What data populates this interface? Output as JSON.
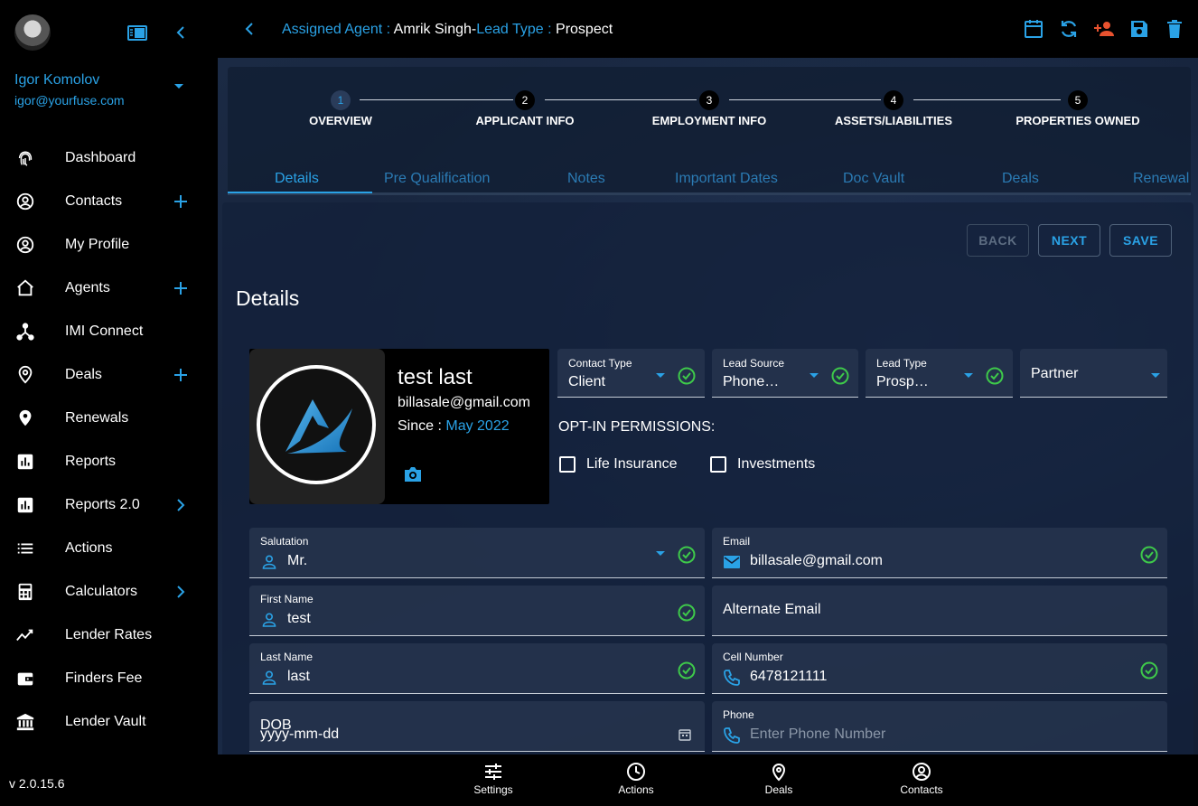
{
  "user": {
    "name": "Igor Komolov",
    "email": "igor@yourfuse.com"
  },
  "sidebar": {
    "items": [
      {
        "label": "Dashboard",
        "icon": "fingerprint-icon",
        "extra": ""
      },
      {
        "label": "Contacts",
        "icon": "account-circle-icon",
        "extra": "plus"
      },
      {
        "label": "My Profile",
        "icon": "account-circle-icon",
        "extra": ""
      },
      {
        "label": "Agents",
        "icon": "home-icon",
        "extra": "plus"
      },
      {
        "label": "IMI Connect",
        "icon": "hub-icon",
        "extra": ""
      },
      {
        "label": "Deals",
        "icon": "location-outline-icon",
        "extra": "plus"
      },
      {
        "label": "Renewals",
        "icon": "location-filled-icon",
        "extra": ""
      },
      {
        "label": "Reports",
        "icon": "bar-chart-icon",
        "extra": ""
      },
      {
        "label": "Reports 2.0",
        "icon": "bar-chart-icon",
        "extra": "chevron"
      },
      {
        "label": "Actions",
        "icon": "list-icon",
        "extra": ""
      },
      {
        "label": "Calculators",
        "icon": "calculator-icon",
        "extra": "chevron"
      },
      {
        "label": "Lender Rates",
        "icon": "trending-icon",
        "extra": ""
      },
      {
        "label": "Finders Fee",
        "icon": "wallet-icon",
        "extra": ""
      },
      {
        "label": "Lender Vault",
        "icon": "bank-icon",
        "extra": ""
      }
    ],
    "version": "v 2.0.15.6"
  },
  "header": {
    "agent_label": "Assigned Agent : ",
    "agent_value": "Amrik Singh",
    "sep": "-",
    "lead_label": "Lead Type : ",
    "lead_value": "Prospect"
  },
  "stepper": {
    "steps": [
      {
        "num": "1",
        "label": "OVERVIEW"
      },
      {
        "num": "2",
        "label": "APPLICANT INFO"
      },
      {
        "num": "3",
        "label": "EMPLOYMENT INFO"
      },
      {
        "num": "4",
        "label": "ASSETS/LIABILITIES"
      },
      {
        "num": "5",
        "label": "PROPERTIES OWNED"
      }
    ]
  },
  "tabs": [
    "Details",
    "Pre Qualification",
    "Notes",
    "Important Dates",
    "Doc Vault",
    "Deals",
    "Renewal"
  ],
  "actions": {
    "back": "BACK",
    "next": "NEXT",
    "save": "SAVE"
  },
  "section_title": "Details",
  "profile": {
    "name": "test last",
    "email": "billasale@gmail.com",
    "since_label": "Since : ",
    "since_value": "May 2022"
  },
  "selects": {
    "contact_type": {
      "label": "Contact Type",
      "value": "Client"
    },
    "lead_source": {
      "label": "Lead Source",
      "value": "Phone…"
    },
    "lead_type": {
      "label": "Lead Type",
      "value": "Prosp…"
    },
    "partner": {
      "value": "Partner"
    }
  },
  "optin": {
    "title": "OPT-IN PERMISSIONS:",
    "life": "Life Insurance",
    "investments": "Investments"
  },
  "fields": {
    "salutation": {
      "label": "Salutation",
      "value": "Mr."
    },
    "email": {
      "label": "Email",
      "value": "billasale@gmail.com"
    },
    "first_name": {
      "label": "First Name",
      "value": "test"
    },
    "alt_email": {
      "value": "Alternate Email"
    },
    "last_name": {
      "label": "Last Name",
      "value": "last"
    },
    "cell": {
      "label": "Cell Number",
      "value": "6478121111"
    },
    "dob": {
      "label": "DOB",
      "value": "yyyy-mm-dd"
    },
    "phone": {
      "label": "Phone",
      "placeholder": "Enter Phone Number"
    }
  },
  "bottom_nav": [
    {
      "label": "Settings"
    },
    {
      "label": "Actions"
    },
    {
      "label": "Deals"
    },
    {
      "label": "Contacts"
    }
  ],
  "colors": {
    "accent": "#2aa2e6",
    "success": "#3ec94a",
    "danger": "#e8522f"
  }
}
